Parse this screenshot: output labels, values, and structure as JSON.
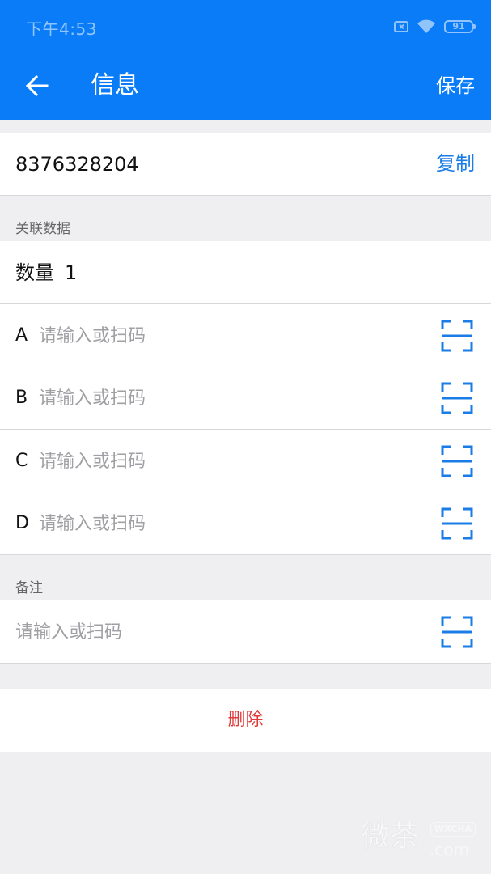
{
  "status_bar": {
    "time": "下午4:53",
    "battery": "91"
  },
  "header": {
    "title": "信息",
    "save_label": "保存"
  },
  "record": {
    "id": "8376328204",
    "copy_label": "复制"
  },
  "related": {
    "section_label": "关联数据",
    "count_label": "数量",
    "count_value": "1",
    "fields": [
      {
        "label": "A",
        "placeholder": "请输入或扫码",
        "value": ""
      },
      {
        "label": "B",
        "placeholder": "请输入或扫码",
        "value": ""
      },
      {
        "label": "C",
        "placeholder": "请输入或扫码",
        "value": ""
      },
      {
        "label": "D",
        "placeholder": "请输入或扫码",
        "value": ""
      }
    ]
  },
  "note": {
    "section_label": "备注",
    "placeholder": "请输入或扫码",
    "value": ""
  },
  "actions": {
    "delete_label": "删除"
  },
  "watermark": {
    "text": "微茶",
    "badge": "WXCHA",
    "domain": ".com"
  },
  "colors": {
    "header_bg": "#0a7cf8",
    "accent": "#1a7ce6",
    "danger": "#e03b3b",
    "page_bg": "#efeff2"
  },
  "icons": {
    "back": "arrow-left-icon",
    "scan": "scan-icon"
  }
}
